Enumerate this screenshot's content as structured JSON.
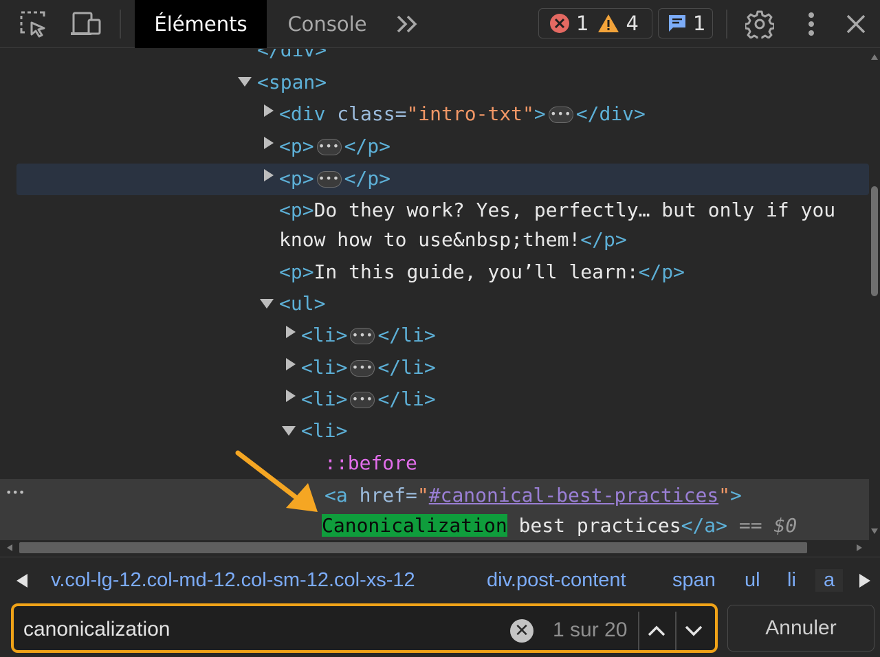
{
  "toolbar": {
    "tabs": [
      {
        "label": "Éléments",
        "active": true
      },
      {
        "label": "Console",
        "active": false
      }
    ],
    "errors_count": "1",
    "warnings_count": "4",
    "messages_count": "1",
    "icons": [
      "select-element-icon",
      "device-toggle-icon",
      "more-tabs-icon",
      "error-icon",
      "warning-icon",
      "message-icon",
      "settings-gear-icon",
      "kebab-menu-icon",
      "close-icon"
    ]
  },
  "tree": {
    "closing_div": "</div>",
    "span_open": "<span>",
    "div_open": "<div ",
    "class_attr": "class",
    "eq": "=",
    "intro_class": "\"intro-txt\"",
    "div_gt": ">",
    "div_close": "</div>",
    "p_open": "<p>",
    "p_close": "</p>",
    "p1_text": "Do they work? Yes, perfectly… but only if you",
    "p1_text2": "know how to use&nbsp;them!",
    "p2_text": "In this guide, you’ll learn:",
    "ul_open": "<ul>",
    "li_open": "<li>",
    "li_close": "</li>",
    "pseudo": "::before",
    "a_open": "<a ",
    "href_attr": "href",
    "href_q1": "\"",
    "href_value": "#canonical-best-practices",
    "href_q2": "\"",
    "a_gt": ">",
    "match_text": "Canonicalization",
    "a_text": " best practices",
    "a_close": "</a>",
    "dollar": " == $0",
    "row_more": "•••",
    "ellipsis": "•••"
  },
  "breadcrumbs": [
    "v.col-lg-12.col-md-12.col-sm-12.col-xs-12",
    "div.post-content",
    "span",
    "ul",
    "li",
    "a"
  ],
  "search": {
    "value": "canonicalization",
    "match_count": "1 sur 20",
    "cancel_label": "Annuler",
    "clear_symbol": "✕"
  },
  "colors": {
    "match_highlight": "#0f9d3c",
    "search_border": "#f0a318",
    "annotation_arrow": "#f5a623"
  }
}
